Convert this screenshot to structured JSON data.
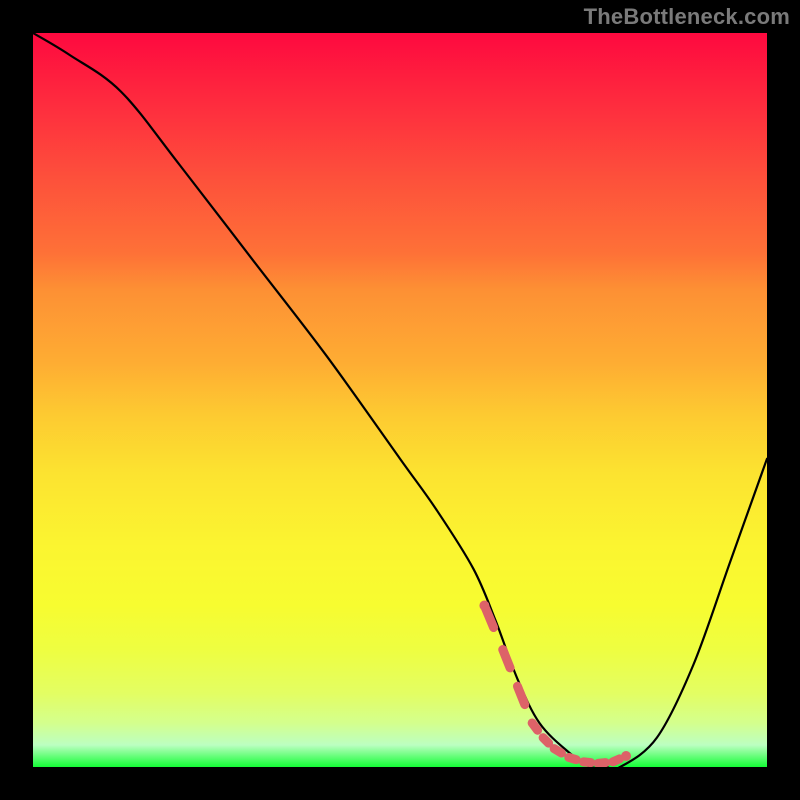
{
  "watermark": "TheBottleneck.com",
  "chart_data": {
    "type": "line",
    "title": "",
    "xlabel": "",
    "ylabel": "",
    "xlim": [
      0,
      100
    ],
    "ylim": [
      0,
      100
    ],
    "curve": {
      "x": [
        0,
        5,
        12,
        20,
        30,
        40,
        50,
        55,
        60,
        63,
        66,
        69,
        73,
        76,
        78,
        80,
        85,
        90,
        95,
        100
      ],
      "y": [
        100,
        97,
        92,
        82,
        69,
        56,
        42,
        35,
        27,
        20,
        12,
        6,
        2,
        0,
        0,
        0,
        4,
        14,
        28,
        42
      ]
    },
    "highlight": {
      "color": "#dd6268",
      "x": [
        61.5,
        64,
        66,
        68,
        69.5,
        71,
        73,
        75,
        77,
        79,
        80.8
      ],
      "y": [
        22,
        16,
        11,
        6,
        4,
        2.5,
        1.3,
        0.7,
        0.5,
        0.7,
        1.5
      ]
    },
    "gradient_stops": [
      {
        "pos": 0,
        "color": "#fe093f"
      },
      {
        "pos": 50,
        "color": "#fdca31"
      },
      {
        "pos": 80,
        "color": "#f7fc30"
      },
      {
        "pos": 100,
        "color": "#14fd36"
      }
    ]
  }
}
